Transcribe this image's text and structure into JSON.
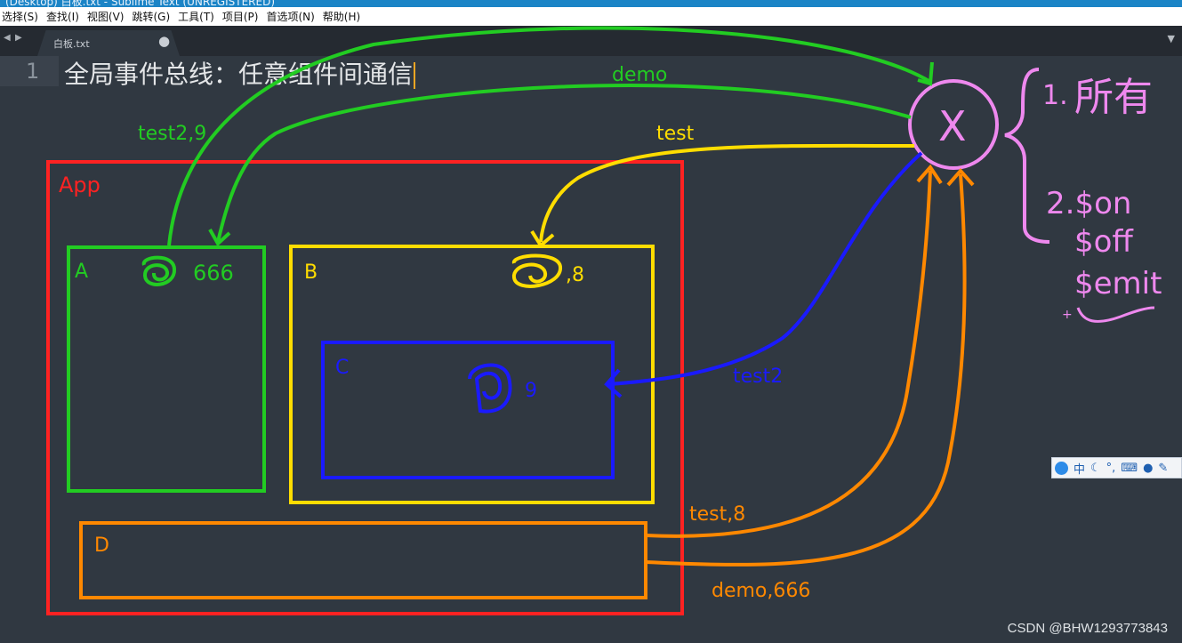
{
  "window": {
    "title": "(Desktop) 白板.txt - Sublime Text (UNREGISTERED)"
  },
  "menu": [
    {
      "label": "选择(S)"
    },
    {
      "label": "查找(I)"
    },
    {
      "label": "视图(V)"
    },
    {
      "label": "跳转(G)"
    },
    {
      "label": "工具(T)"
    },
    {
      "label": "项目(P)"
    },
    {
      "label": "首选项(N)"
    },
    {
      "label": "帮助(H)"
    }
  ],
  "tab": {
    "name": "白板.txt",
    "modified_dot": "●"
  },
  "editor": {
    "line_number": "1",
    "line_text": "全局事件总线：任意组件间通信"
  },
  "annotations": {
    "app": "App",
    "a": "A",
    "a_value": "666",
    "b": "B",
    "b_value": ",8",
    "c": "C",
    "c_value": "9",
    "d": "D",
    "demo": "demo",
    "test": "test",
    "test2_9": "test2,9",
    "test2": "test2",
    "test_8": "test,8",
    "demo_666": "demo,666",
    "bus": "X",
    "note1": "1.",
    "note_scribble": "所有",
    "note2_on": "2.$on",
    "note2_off": "$off",
    "note2_emit": "$emit",
    "plus": "+"
  },
  "colors": {
    "background": "#303841",
    "app": "#ff2222",
    "a": "#22cc22",
    "b": "#ffdd00",
    "c": "#1a1aff",
    "d": "#ff8800",
    "demo_arrow": "#22cc22",
    "test_arrow": "#ffdd00",
    "bus": "#ee88ee"
  },
  "ime": {
    "label": "中",
    "icons": [
      "moon-icon",
      "punct-icon",
      "keyboard-icon",
      "user-icon",
      "wrench-icon"
    ]
  },
  "watermark": "CSDN @BHW1293773843"
}
